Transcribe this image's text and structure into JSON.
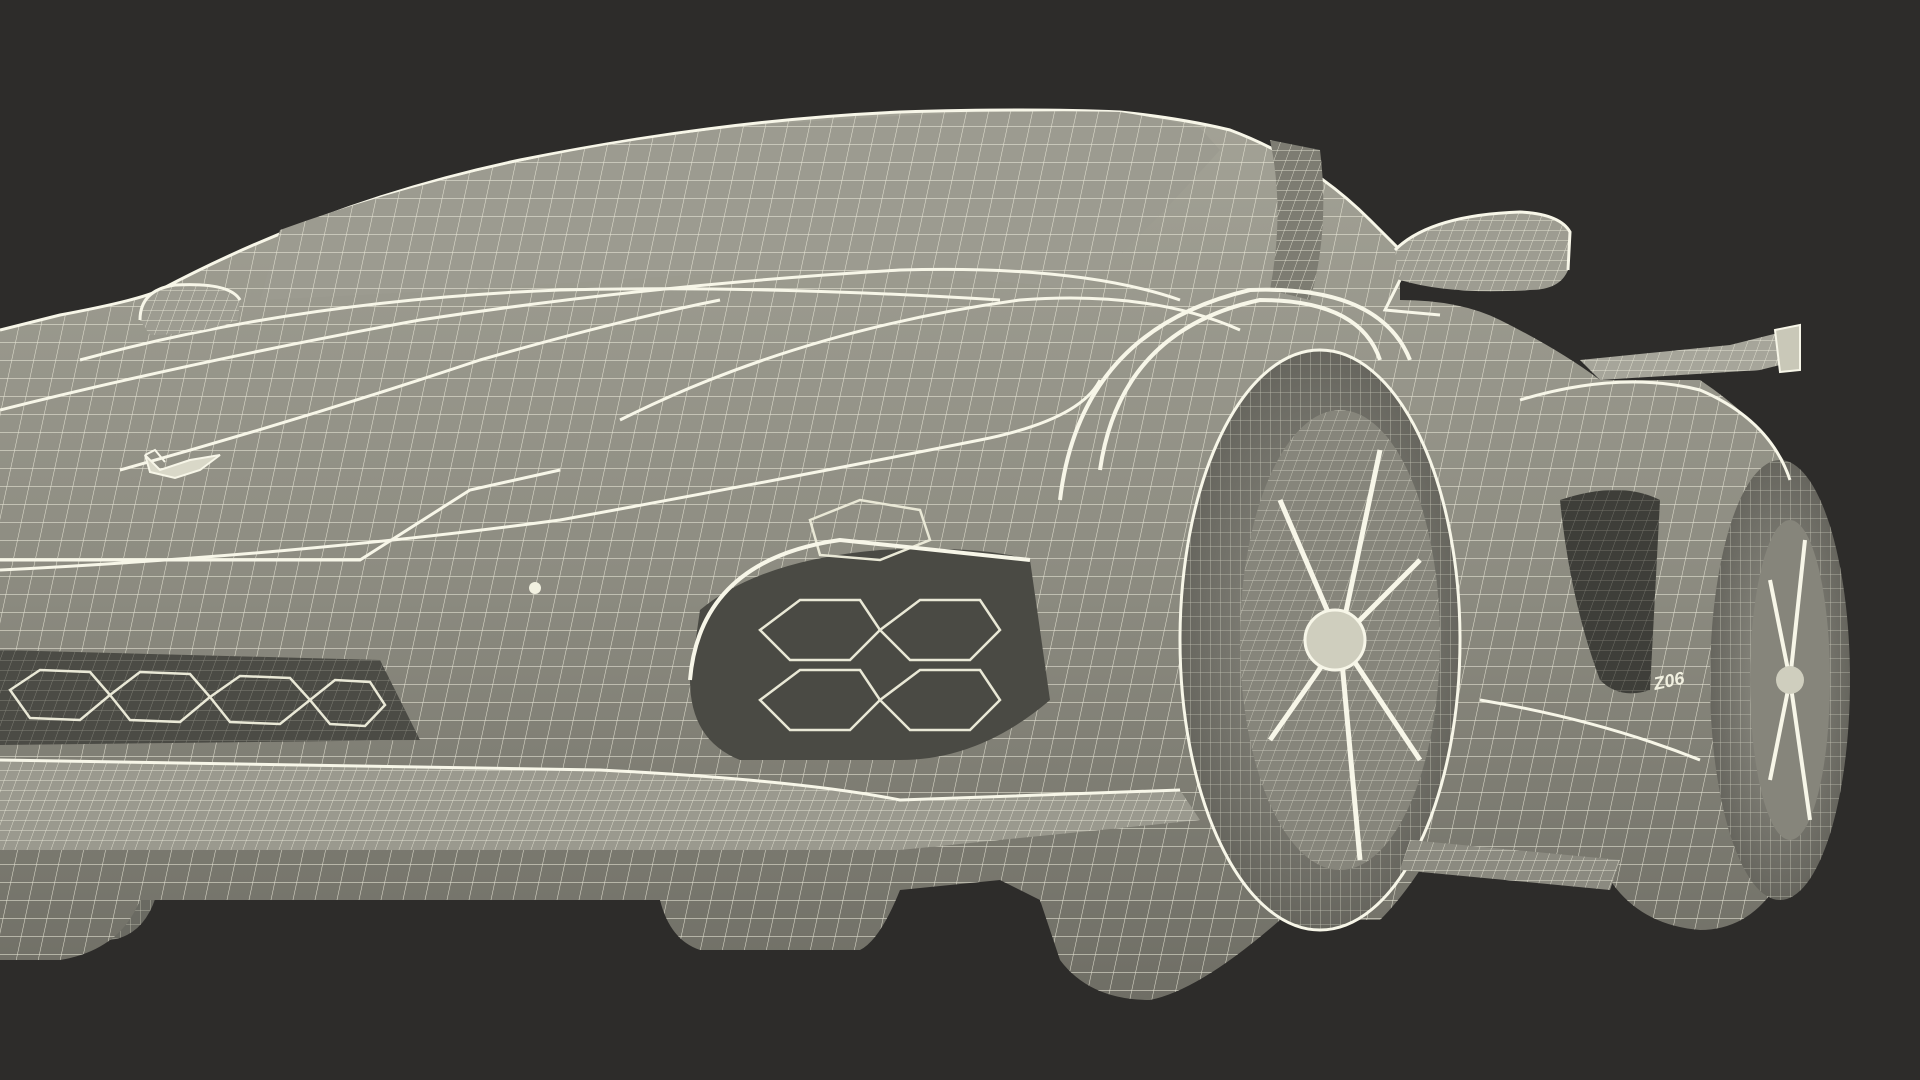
{
  "scene": {
    "subject": "sports-car-wireframe-render",
    "background_color": "#2d2c2a",
    "surface_color": "#908f83",
    "wire_color": "#f1f0e0",
    "shadow_color": "#55554d",
    "dark_opening_color": "#3e3e39"
  },
  "badges": {
    "hood_emblem": "crossed-flags-emblem",
    "side_badge": "Z06"
  }
}
